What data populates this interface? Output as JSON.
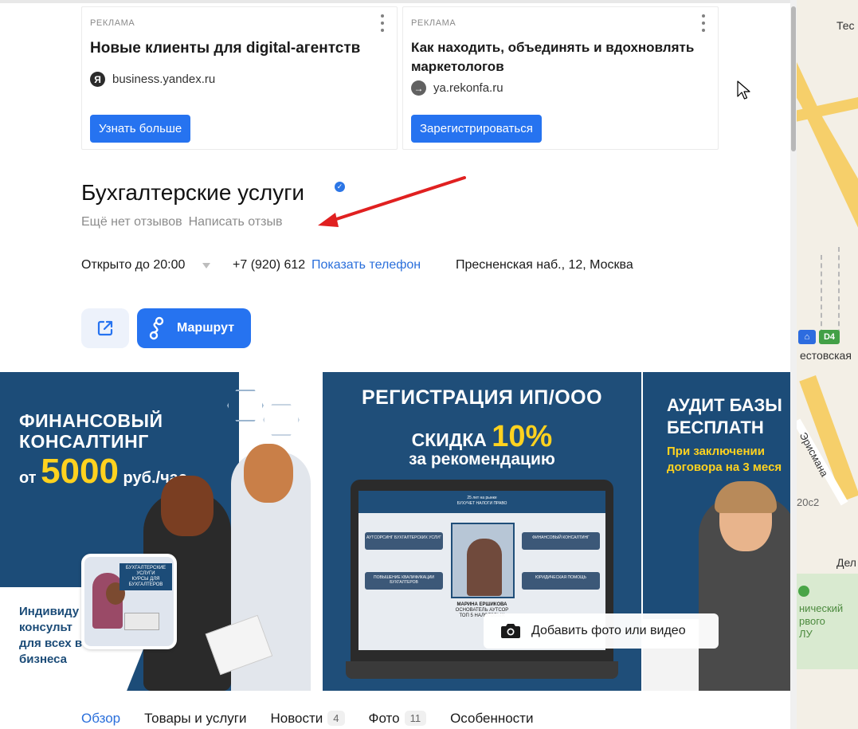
{
  "ads": [
    {
      "tag": "РЕКЛАМА",
      "title": "Новые клиенты для digital-агентств",
      "source_icon": "Я",
      "source": "business.yandex.ru",
      "cta": "Узнать больше"
    },
    {
      "tag": "РЕКЛАМА",
      "title": "Как находить, объединять и вдохновлять маркетологов",
      "source_icon": "→",
      "source": "ya.rekonfa.ru",
      "cta": "Зарегистрироваться"
    }
  ],
  "org": {
    "title": "Бухгалтерские услуги",
    "no_reviews": "Ещё нет отзывов",
    "write_review": "Написать отзыв",
    "hours": "Открыто до 20:00",
    "phone_partial": "+7 (920) 612",
    "show_phone": "Показать телефон",
    "address": "Пресненская наб., 12, Москва"
  },
  "actions": {
    "route_label": "Маршрут"
  },
  "gallery": {
    "slide1": {
      "line1": "ФИНАНСОВЫЙ",
      "line2": "КОНСАЛТИНГ",
      "from": "от",
      "price": "5000",
      "unit": "руб./час",
      "bottom1": "Индивиду",
      "bottom2": "консульт",
      "bottom3": "для всех в",
      "bottom4": "бизнеса",
      "thumb_line1": "БУХГАЛТЕРСКИЕ",
      "thumb_line2": "УСЛУГИ",
      "thumb_line3": "КУРСЫ ДЛЯ",
      "thumb_line4": "БУХГАЛТЕРОВ"
    },
    "slide2": {
      "line1": "РЕГИСТРАЦИЯ ИП/ООО",
      "line2": "СКИДКА",
      "pct": "10%",
      "line3": "за рекомендацию",
      "screen_header1": "25 лет на рынке",
      "screen_header2": "БУХУЧЕТ НАЛОГИ ПРАВО",
      "pill1": "АУТСОРСИНГ БУХГАЛТЕРСКИХ УСЛУГ",
      "pill2": "ФИНАНСОВЫЙ КОНСАЛТИНГ",
      "pill3": "ПОВЫШЕНИЕ КВАЛИФИКАЦИИ БУХГАЛТЕРОВ",
      "pill4": "ЮРИДИЧЕСКАЯ ПОМОЩЬ",
      "caption1": "МАРИНА ЕРШИКОВА",
      "caption2": "ОСНОВАТЕЛЬ АУТСОР",
      "caption3": "ТОП 5 НАЛОГОВЫХ"
    },
    "slide3": {
      "line1": "АУДИТ БАЗЫ",
      "line2": "БЕСПЛАТН",
      "line3": "При заключении",
      "line4": "договора на 3 меся"
    },
    "add_photo": "Добавить фото или видео"
  },
  "tabs": [
    {
      "label": "Обзор",
      "count": ""
    },
    {
      "label": "Товары и услуги",
      "count": ""
    },
    {
      "label": "Новости",
      "count": "4"
    },
    {
      "label": "Фото",
      "count": "11"
    },
    {
      "label": "Особенности",
      "count": ""
    }
  ],
  "map": {
    "label_top": "Тес",
    "metro_badge": "D4",
    "station": "естовская",
    "street": "Эрисмана",
    "code": "20с2",
    "place1": "Дел",
    "park1": "нический",
    "park2": "рвого",
    "park3": "ЛУ"
  },
  "colors": {
    "accent": "#2673f0",
    "link": "#2a6fdb",
    "banner_blue": "#1c4c78",
    "banner_yellow": "#ffd21f",
    "annotation_red": "#e02020"
  }
}
